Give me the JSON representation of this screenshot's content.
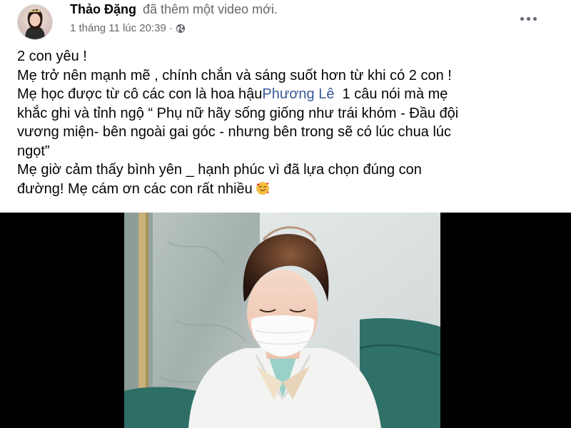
{
  "post": {
    "author_name": "Thảo Đặng",
    "action": "đã thêm một video mới.",
    "timestamp": "1 tháng 11 lúc 20:39",
    "separator": "·",
    "privacy_icon": "globe-icon",
    "more_icon": "more-options-icon"
  },
  "text": {
    "line1": "2 con yêu !",
    "line2": "Mẹ trở nên mạnh mẽ , chính chắn và sáng suốt hơn từ khi có 2 con !",
    "line3_before": "Mẹ học được từ cô các con là hoa hậu",
    "mention": "Phương Lê",
    "line3_after": "  1 câu nói mà mẹ",
    "line4": "khắc ghi và tỉnh ngộ “ Phụ nữ hãy sống giống như trái khóm - Đầu đội",
    "line5": "vương miện- bên ngoài gai góc - nhưng bên trong sẽ có lúc chua lúc",
    "line6": "ngọt”",
    "line7": "Mẹ giờ cảm thấy bình yên _ hạnh phúc vì đã lựa chọn đúng con",
    "line8": "đường! Mẹ cám ơn các con rất nhiều",
    "emoji": "smiling-face-with-hearts-icon"
  },
  "video": {
    "content": "video-thumbnail"
  },
  "colors": {
    "mention": "#385898",
    "secondary_text": "#65676b",
    "video_background": "#000000"
  }
}
